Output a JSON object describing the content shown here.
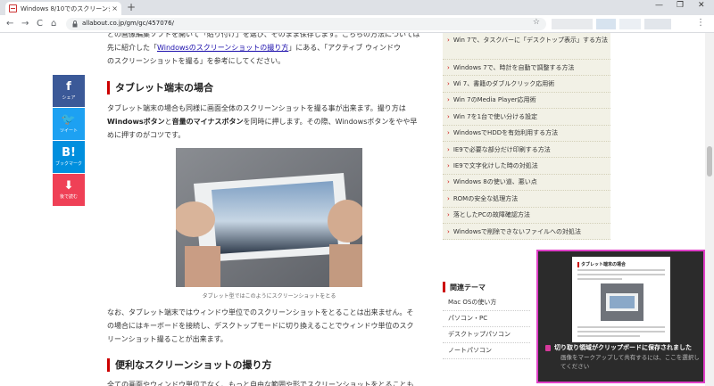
{
  "browser": {
    "tab_title": "Windows 8/10でのスクリーンショット…",
    "tab_close": "×",
    "new_tab": "+",
    "back": "←",
    "forward": "→",
    "reload": "C",
    "home": "⌂",
    "url": "allabout.co.jp/gm/gc/457076/",
    "star": "☆",
    "menu": "⋮",
    "win_min": "—",
    "win_max": "❐",
    "win_close": "✕"
  },
  "article": {
    "intro_line1": "どの画像編集ソフトを開いて「貼り付け」を選び、そのまま保存します。こちらの方法については",
    "intro_line2_pre": "先に紹介した「",
    "intro_link": "Windowsのスクリーンショットの撮り方",
    "intro_line2_post": "」にある、「アクティブ ウィンドウ",
    "intro_line3": "のスクリーンショットを撮る」を参考にしてください。",
    "h_tablet": "タブレット端末の場合",
    "tablet_p1": "タブレット端末の場合も同様に画面全体のスクリーンショットを撮る事が出来ます。撮り方は",
    "tablet_b1": "Windowsボタン",
    "tablet_mid": "と",
    "tablet_b2": "音量のマイナスボタン",
    "tablet_p2": "を同時に押します。その際、Windowsボタンをやや早",
    "tablet_p3": "めに押すのがコツです。",
    "photo_caption": "タブレット型ではこのようにスクリーンショットをとる",
    "after_p1": "なお、タブレット端末ではウィンドウ単位でのスクリーンショットをとることは出来ません。そ",
    "after_p2": "の場合にはキーボードを接続し、デスクトップモードに切り換えることでウィンドウ単位のスク",
    "after_p3": "リーンショット撮ることが出来ます。",
    "h_convenient": "便利なスクリーンショットの撮り方",
    "last_line": "全ての画面やウィンドウ単位でなく、もっと自由な範囲や形でスクリーンショットをとることも"
  },
  "share": [
    {
      "icon": "f",
      "label": "シェア",
      "color": "#3b5998"
    },
    {
      "icon": "🐦",
      "label": "ツイート",
      "color": "#1da1f2"
    },
    {
      "icon": "B!",
      "label": "ブックマーク",
      "color": "#008fde"
    },
    {
      "icon": "⬇",
      "label": "後で読む",
      "color": "#ef4056"
    }
  ],
  "sidebar": {
    "items": [
      "Win 7で、タスクバーに「デスクトップ表示」する方法",
      "Windows 7で、時計を自動で調整する方法",
      "Wi 7、書籍のダブルクリック応用術",
      "Win 7のMedia Player応用術",
      "Win 7を1台で使い分ける設定",
      "WindowsでHDDを有効利用する方法",
      "IE9で必要な部分だけ印刷する方法",
      "IE9で文字化けした時の対処法",
      "Windows 8の使い道、悪い点",
      "ROMの安全な処理方法",
      "落としたPCの故障確認方法",
      "Windowsで削除できないファイルへの対処法"
    ],
    "theme_title": "関連テーマ",
    "themes": [
      "Mac OSの使い方",
      "パソコン・PC",
      "デスクトップパソコン",
      "ノートパソコン"
    ]
  },
  "toast": {
    "title": "切り取り領域がクリップボードに保存されました",
    "body": "画像をマークアップして共有するには、ここを選択してください",
    "preview_heading": "タブレット端末の場合"
  }
}
